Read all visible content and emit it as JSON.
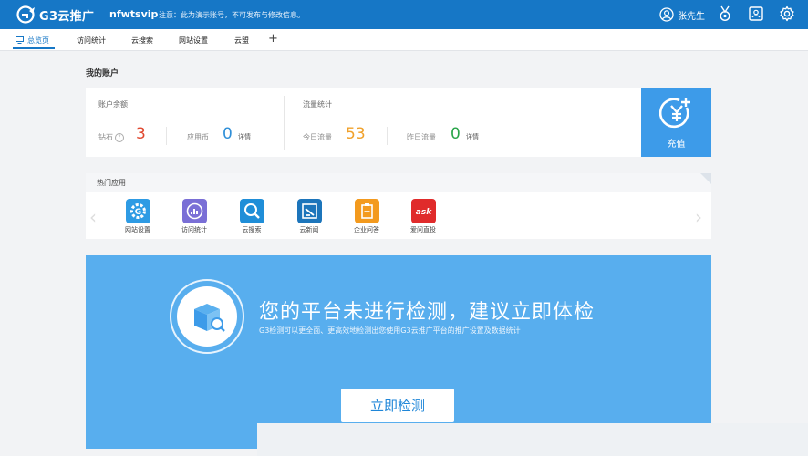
{
  "header": {
    "logo_text": "G3云推广",
    "account": "nfwtsvip",
    "notice": "注意：此为演示账号，不可发布与修改信息。",
    "user_name": "张先生"
  },
  "tabs": [
    {
      "label": "总览页"
    },
    {
      "label": "访问统计"
    },
    {
      "label": "云搜索"
    },
    {
      "label": "网站设置"
    },
    {
      "label": "云盟"
    }
  ],
  "tab_add": "+",
  "section_title": "我的账户",
  "account": {
    "balance_label": "账户余额",
    "diamond_label": "钻石",
    "diamond_value": "3",
    "coin_label": "应用币",
    "coin_value": "0",
    "detail": "详情",
    "traffic_label": "流量统计",
    "today_label": "今日流量",
    "today_value": "53",
    "yesterday_label": "昨日流量",
    "yesterday_value": "0",
    "detail2": "详情"
  },
  "recharge": {
    "label": "充值"
  },
  "apps": {
    "title": "热门应用",
    "items": [
      {
        "label": "网站设置",
        "color": "#2e9be4"
      },
      {
        "label": "访问统计",
        "color": "#7a6fd6"
      },
      {
        "label": "云搜索",
        "color": "#1f8ed8"
      },
      {
        "label": "云新闻",
        "color": "#1c75bb"
      },
      {
        "label": "企业问答",
        "color": "#f39a1e"
      },
      {
        "label": "爱问直投",
        "color": "#e02b2b"
      }
    ]
  },
  "banner": {
    "title": "您的平台未进行检测，建议立即体检",
    "subtitle": "G3检测可以更全面、更高效地检测出您使用G3云推广平台的推广设置及数据统计",
    "button": "立即检测"
  },
  "colors": {
    "brand": "#1677c6",
    "banner": "#58aeee",
    "orange": "#f0a12b",
    "green": "#2aa54a",
    "red": "#e0482f",
    "blue": "#2f8fd8"
  }
}
